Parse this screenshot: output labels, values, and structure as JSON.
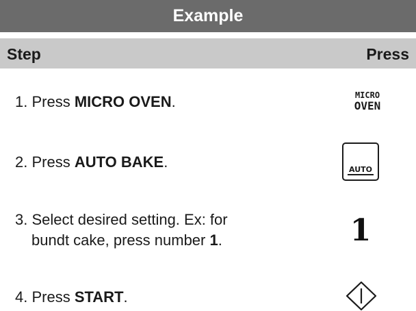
{
  "title": "Example",
  "header": {
    "step": "Step",
    "press": "Press"
  },
  "steps": [
    {
      "prefix": "1. Press ",
      "bold": "MICRO OVEN",
      "suffix": "."
    },
    {
      "prefix": "2. Press ",
      "bold": "AUTO BAKE",
      "suffix": "."
    },
    {
      "line1": "3. Select desired setting. Ex: for",
      "line2_prefix": "bundt cake, press number ",
      "bold": "1",
      "suffix": "."
    },
    {
      "prefix": "4. Press ",
      "bold": "START",
      "suffix": "."
    }
  ],
  "press": {
    "micro_line1": "MICRO",
    "micro_line2": "OVEN",
    "auto_label": "AUTO",
    "number": "1",
    "start_icon": "start-diamond-icon"
  }
}
